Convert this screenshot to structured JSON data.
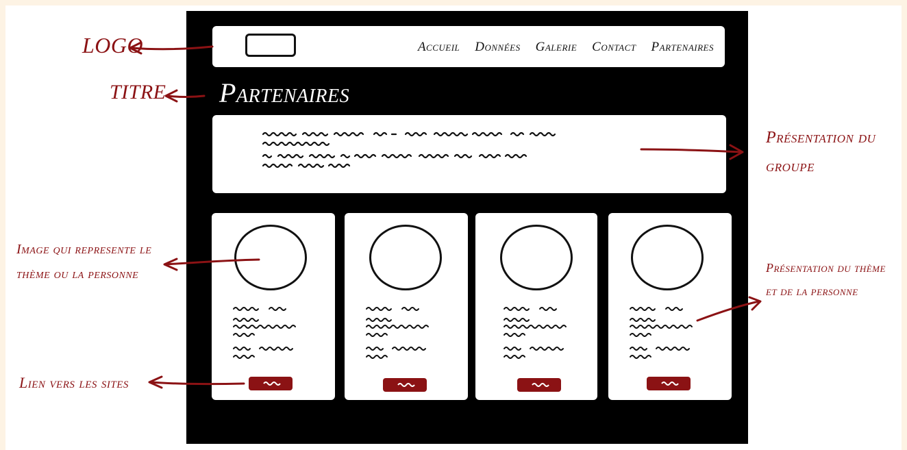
{
  "nav": {
    "links": [
      "Accueil",
      "Données",
      "Galerie",
      "Contact",
      "Partenaires"
    ]
  },
  "page_title": "Partenaires",
  "annotations": {
    "logo": "LOGO",
    "titre": "TITRE",
    "presentation_groupe": [
      "Présentation du",
      "groupe"
    ],
    "image": [
      "Image qui represente le",
      "thème ou la personne"
    ],
    "presentation_theme": [
      "Présentation du thème",
      "et de la personne"
    ],
    "lien": "Lien vers les sites"
  },
  "colors": {
    "background": "#fdf3e4",
    "frame": "#000000",
    "accent": "#8b1214"
  },
  "icons": {
    "placeholder_text": "scribble",
    "image_placeholder": "circle"
  }
}
